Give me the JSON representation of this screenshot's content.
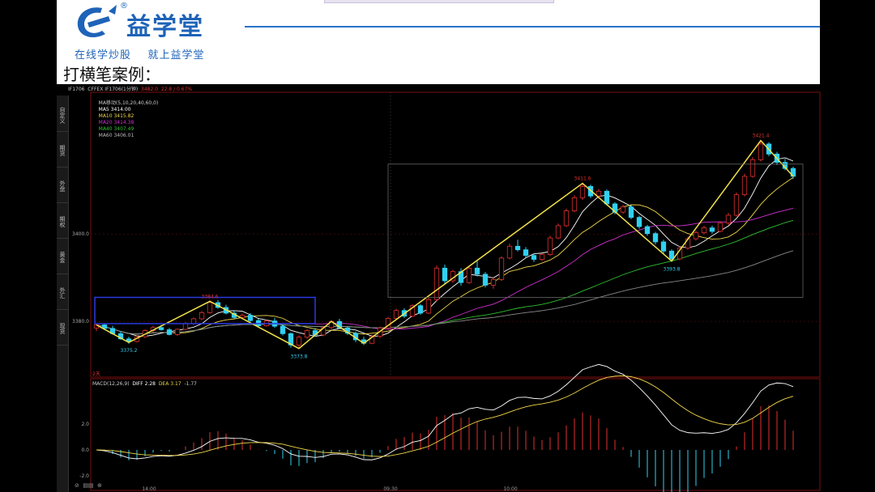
{
  "slide": {
    "brand": "益学堂",
    "reg_mark": "®",
    "slogan": "在线学炒股    就上益学堂",
    "title": "打横笔案例："
  },
  "app": {
    "symbol_line": "IF1706  CFFEX IF1706(1分钟)",
    "price": "3482.0",
    "change": "22.8 / 0.67%",
    "ma_title": "MA移动(5,10,20,40,60,0)",
    "ma": [
      {
        "label": "MA5 3414.00",
        "color": "#ffffff"
      },
      {
        "label": "MA10 3415.82",
        "color": "#f2d84a"
      },
      {
        "label": "MA20 3414.38",
        "color": "#d030d0"
      },
      {
        "label": "MA40 3407.49",
        "color": "#30c030"
      },
      {
        "label": "MA60 3406.01",
        "color": "#bbbbbb"
      }
    ],
    "sidebar_tabs": [
      "自定义",
      "期货",
      "外盘",
      "期权",
      "黄金",
      "外汇",
      "现货"
    ],
    "macd_label": "MACD(12,26,9)",
    "diff_label": "DIFF",
    "diff_value": "2.28",
    "dea_label": "DEA",
    "dea_value": "3.17",
    "macd_value": "-1.77",
    "bottom_tools": "⊘  ▤▤  ⊕",
    "period_label": "2天",
    "annotations": {
      "low1": "3375.2",
      "high1": "3384.6",
      "low2": "3373.8",
      "high2": "3411.6",
      "low3": "3393.8",
      "high3": "3421.4"
    },
    "y_ticks": {
      "main_upper": "3400.0",
      "main_lower": "3380.0",
      "macd_upper": "2.0",
      "macd_zero": "0.0",
      "macd_lower": "-2.0"
    },
    "x_ticks": [
      "14:00",
      "09:30",
      "10:00"
    ]
  },
  "chart_data": {
    "type": "candlestick",
    "title": "IF1706 1分钟",
    "ylim": [
      3368,
      3428
    ],
    "y_ticks": [
      3380,
      3400
    ],
    "annotated_points": [
      {
        "label": "3375.2",
        "y": 3375.2
      },
      {
        "label": "3384.6",
        "y": 3384.6
      },
      {
        "label": "3373.8",
        "y": 3373.8
      },
      {
        "label": "3411.6",
        "y": 3411.6
      },
      {
        "label": "3393.8",
        "y": 3393.8
      },
      {
        "label": "3421.4",
        "y": 3421.4
      }
    ],
    "candles": [
      [
        3378.5,
        3379.5,
        3377.8,
        3379.2
      ],
      [
        3379.2,
        3379.4,
        3378.0,
        3378.4
      ],
      [
        3378.4,
        3379.0,
        3377.0,
        3377.2
      ],
      [
        3377.2,
        3377.8,
        3375.8,
        3376.0
      ],
      [
        3376.0,
        3376.5,
        3374.9,
        3375.4
      ],
      [
        3375.4,
        3376.8,
        3375.2,
        3376.5
      ],
      [
        3376.5,
        3378.2,
        3376.2,
        3377.9
      ],
      [
        3377.9,
        3379.0,
        3377.5,
        3378.6
      ],
      [
        3378.6,
        3379.2,
        3377.9,
        3378.1
      ],
      [
        3378.1,
        3378.5,
        3376.8,
        3377.0
      ],
      [
        3377.0,
        3378.4,
        3376.7,
        3378.2
      ],
      [
        3378.2,
        3379.8,
        3378.0,
        3379.5
      ],
      [
        3379.5,
        3380.9,
        3379.2,
        3380.6
      ],
      [
        3380.6,
        3382.4,
        3380.3,
        3382.0
      ],
      [
        3382.0,
        3384.8,
        3381.8,
        3384.3
      ],
      [
        3384.3,
        3384.9,
        3382.9,
        3383.2
      ],
      [
        3383.2,
        3383.8,
        3381.6,
        3381.9
      ],
      [
        3381.9,
        3382.5,
        3380.6,
        3380.9
      ],
      [
        3380.9,
        3381.8,
        3380.5,
        3381.4
      ],
      [
        3381.4,
        3381.9,
        3379.9,
        3380.2
      ],
      [
        3380.2,
        3380.6,
        3378.7,
        3379.0
      ],
      [
        3379.0,
        3380.4,
        3378.8,
        3380.1
      ],
      [
        3380.1,
        3380.8,
        3378.5,
        3378.9
      ],
      [
        3378.9,
        3379.3,
        3376.8,
        3377.2
      ],
      [
        3377.2,
        3377.5,
        3374.0,
        3374.6
      ],
      [
        3374.6,
        3376.8,
        3373.8,
        3376.4
      ],
      [
        3376.4,
        3378.2,
        3376.0,
        3377.9
      ],
      [
        3377.9,
        3378.5,
        3376.5,
        3376.9
      ],
      [
        3376.9,
        3378.9,
        3376.6,
        3378.6
      ],
      [
        3378.6,
        3380.3,
        3378.2,
        3380.0
      ],
      [
        3380.0,
        3380.6,
        3378.2,
        3378.5
      ],
      [
        3378.5,
        3378.9,
        3376.9,
        3377.3
      ],
      [
        3377.3,
        3377.7,
        3375.3,
        3375.8
      ],
      [
        3375.8,
        3376.5,
        3374.6,
        3375.0
      ],
      [
        3375.0,
        3377.0,
        3374.8,
        3376.6
      ],
      [
        3376.6,
        3378.8,
        3376.2,
        3378.5
      ],
      [
        3378.5,
        3381.0,
        3378.2,
        3380.7
      ],
      [
        3380.7,
        3382.9,
        3380.3,
        3382.5
      ],
      [
        3382.5,
        3383.0,
        3380.8,
        3381.2
      ],
      [
        3381.2,
        3383.9,
        3381.0,
        3383.6
      ],
      [
        3383.6,
        3384.0,
        3381.5,
        3381.9
      ],
      [
        3381.9,
        3385.4,
        3381.7,
        3385.0
      ],
      [
        3385.0,
        3392.8,
        3384.6,
        3392.2
      ],
      [
        3392.2,
        3393.0,
        3388.6,
        3389.3
      ],
      [
        3389.3,
        3391.8,
        3388.8,
        3391.4
      ],
      [
        3391.4,
        3392.2,
        3388.2,
        3388.9
      ],
      [
        3388.9,
        3392.6,
        3388.6,
        3392.2
      ],
      [
        3392.2,
        3393.8,
        3390.3,
        3390.8
      ],
      [
        3390.8,
        3391.3,
        3387.8,
        3388.3
      ],
      [
        3388.3,
        3390.2,
        3387.5,
        3389.6
      ],
      [
        3389.6,
        3394.9,
        3389.3,
        3394.5
      ],
      [
        3394.5,
        3397.8,
        3394.2,
        3397.2
      ],
      [
        3397.2,
        3398.7,
        3396.0,
        3396.4
      ],
      [
        3396.4,
        3397.0,
        3394.6,
        3395.1
      ],
      [
        3395.1,
        3395.6,
        3393.6,
        3394.2
      ],
      [
        3394.2,
        3395.6,
        3393.8,
        3395.3
      ],
      [
        3395.3,
        3399.6,
        3395.0,
        3399.1
      ],
      [
        3399.1,
        3402.4,
        3398.8,
        3401.9
      ],
      [
        3401.9,
        3405.8,
        3401.6,
        3405.3
      ],
      [
        3405.3,
        3408.9,
        3405.0,
        3408.3
      ],
      [
        3408.3,
        3411.6,
        3407.8,
        3410.9
      ],
      [
        3410.9,
        3411.3,
        3408.2,
        3408.7
      ],
      [
        3408.7,
        3410.3,
        3408.1,
        3409.8
      ],
      [
        3409.8,
        3410.2,
        3406.5,
        3406.9
      ],
      [
        3406.9,
        3407.3,
        3404.5,
        3405.0
      ],
      [
        3405.0,
        3406.7,
        3404.6,
        3406.2
      ],
      [
        3406.2,
        3406.6,
        3403.4,
        3403.8
      ],
      [
        3403.8,
        3404.2,
        3401.2,
        3401.7
      ],
      [
        3401.7,
        3402.1,
        3399.6,
        3400.1
      ],
      [
        3400.1,
        3400.5,
        3397.6,
        3398.2
      ],
      [
        3398.2,
        3398.7,
        3395.5,
        3396.1
      ],
      [
        3396.1,
        3396.5,
        3393.8,
        3394.3
      ],
      [
        3394.3,
        3397.2,
        3394.0,
        3396.8
      ],
      [
        3396.8,
        3399.4,
        3396.4,
        3398.9
      ],
      [
        3398.9,
        3400.8,
        3398.5,
        3400.3
      ],
      [
        3400.3,
        3401.9,
        3399.9,
        3401.4
      ],
      [
        3401.4,
        3401.9,
        3400.1,
        3400.6
      ],
      [
        3400.6,
        3402.9,
        3400.4,
        3402.5
      ],
      [
        3402.5,
        3404.8,
        3402.1,
        3404.3
      ],
      [
        3404.3,
        3409.5,
        3404.0,
        3409.0
      ],
      [
        3409.0,
        3413.8,
        3408.6,
        3413.2
      ],
      [
        3413.2,
        3417.6,
        3412.9,
        3417.0
      ],
      [
        3417.0,
        3421.4,
        3416.6,
        3420.6
      ],
      [
        3420.6,
        3421.0,
        3417.8,
        3418.3
      ],
      [
        3418.3,
        3418.8,
        3415.8,
        3416.4
      ],
      [
        3416.4,
        3417.2,
        3414.6,
        3415.0
      ],
      [
        3415.0,
        3415.4,
        3412.6,
        3413.2
      ]
    ]
  }
}
